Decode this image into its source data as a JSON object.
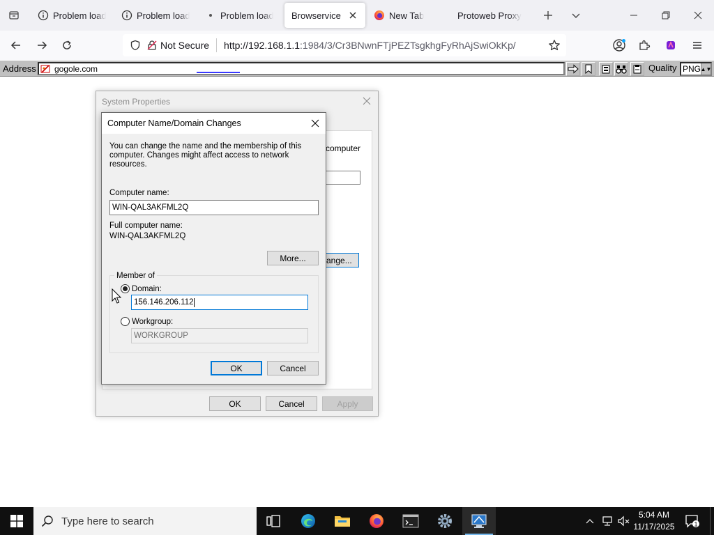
{
  "browser": {
    "tabs": [
      {
        "label": "Problem loading page",
        "icon": "info-icon",
        "active": false
      },
      {
        "label": "Problem loading page",
        "icon": "info-icon",
        "active": false
      },
      {
        "label": "Problem loading page",
        "icon": "dot-icon",
        "active": false
      },
      {
        "label": "Browservice",
        "icon": "none",
        "active": true
      },
      {
        "label": "New Tab",
        "icon": "firefox-icon",
        "active": false
      },
      {
        "label": "Protoweb Proxy",
        "icon": "none",
        "active": false
      }
    ],
    "url_security_label": "Not Secure",
    "url_host": "http://192.168.1.1",
    "url_rest": ":1984/3/Cr3BNwnFTjPEZTsgkhgFyRhAjSwiOkKp/"
  },
  "proxybar": {
    "address_label": "Address",
    "address_value": "gogole.com",
    "quality_label": "Quality",
    "format_value": "PNG"
  },
  "system_properties": {
    "title": "System Properties",
    "fragment_text": "computer",
    "fragment_button": "ange...",
    "ok_label": "OK",
    "cancel_label": "Cancel",
    "apply_label": "Apply"
  },
  "dialog": {
    "title": "Computer Name/Domain Changes",
    "description": "You can change the name and the membership of this computer. Changes might affect access to network resources.",
    "computer_name_label": "Computer name:",
    "computer_name_value": "WIN-QAL3AKFML2Q",
    "full_name_label": "Full computer name:",
    "full_name_value": "WIN-QAL3AKFML2Q",
    "more_label": "More...",
    "member_of_label": "Member of",
    "domain_label": "Domain:",
    "domain_value": "156.146.206.112",
    "workgroup_label": "Workgroup:",
    "workgroup_value": "WORKGROUP",
    "selected_membership": "domain",
    "ok_label": "OK",
    "cancel_label": "Cancel"
  },
  "taskbar": {
    "search_placeholder": "Type here to search",
    "time": "5:04 AM",
    "date": "11/17/2025",
    "notification_count": "1"
  },
  "colors": {
    "accent": "#0078d7",
    "taskbar": "#101010",
    "tabstrip": "#f0f0f4"
  }
}
